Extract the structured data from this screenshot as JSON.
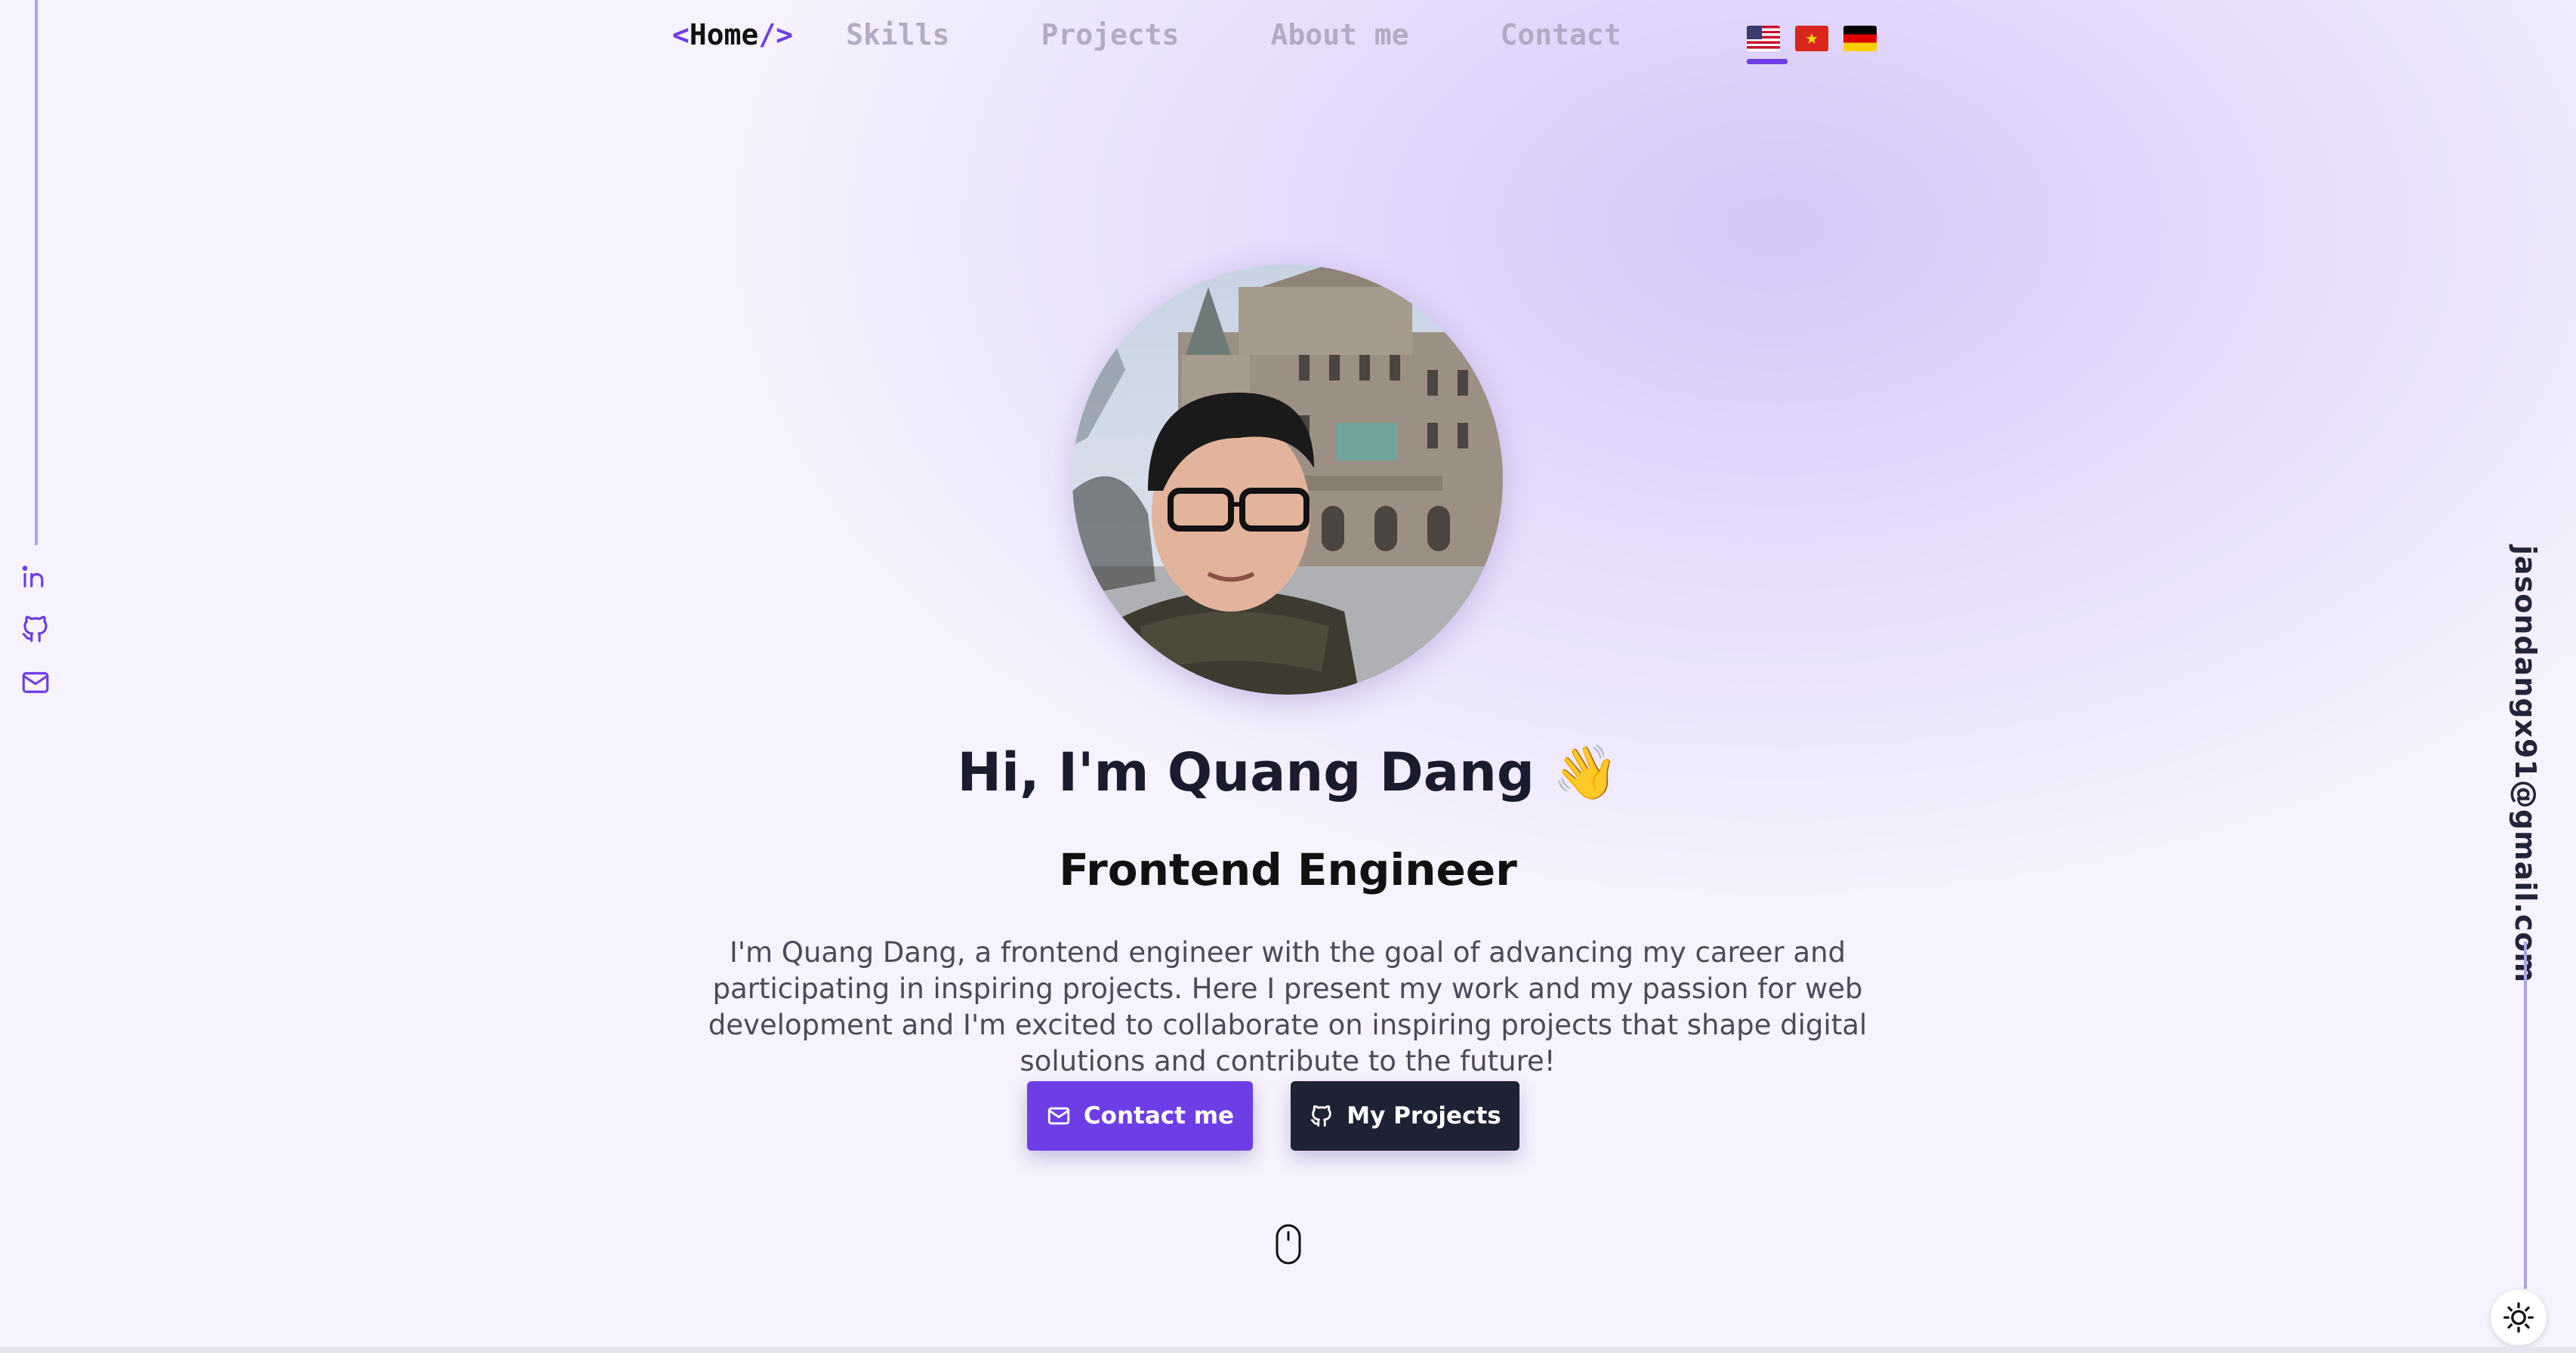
{
  "nav": {
    "home_open": "<",
    "home_label": "Home",
    "home_close": "/>",
    "items": [
      "Skills",
      "Projects",
      "About me",
      "Contact"
    ]
  },
  "languages": [
    {
      "icon": "us-flag-icon",
      "selected": true
    },
    {
      "icon": "vietnam-flag-icon",
      "selected": false
    },
    {
      "icon": "germany-flag-icon",
      "selected": false
    }
  ],
  "social": [
    "linkedin-icon",
    "github-icon",
    "mail-icon"
  ],
  "email": "jasondangx91@gmail.com",
  "hero": {
    "greeting": "Hi, I'm Quang Dang",
    "wave": "👋",
    "role": "Frontend Engineer",
    "intro": "I'm Quang Dang, a frontend engineer with the goal of advancing my career and participating in inspiring projects. Here I present my work and my passion for web development and I'm excited to collaborate on inspiring projects that shape digital solutions and contribute to the future!"
  },
  "buttons": {
    "contact_label": "Contact me",
    "projects_label": "My Projects"
  },
  "colors": {
    "accent": "#6d3ee6",
    "dark": "#1e2235",
    "line": "#a9a4ea"
  }
}
